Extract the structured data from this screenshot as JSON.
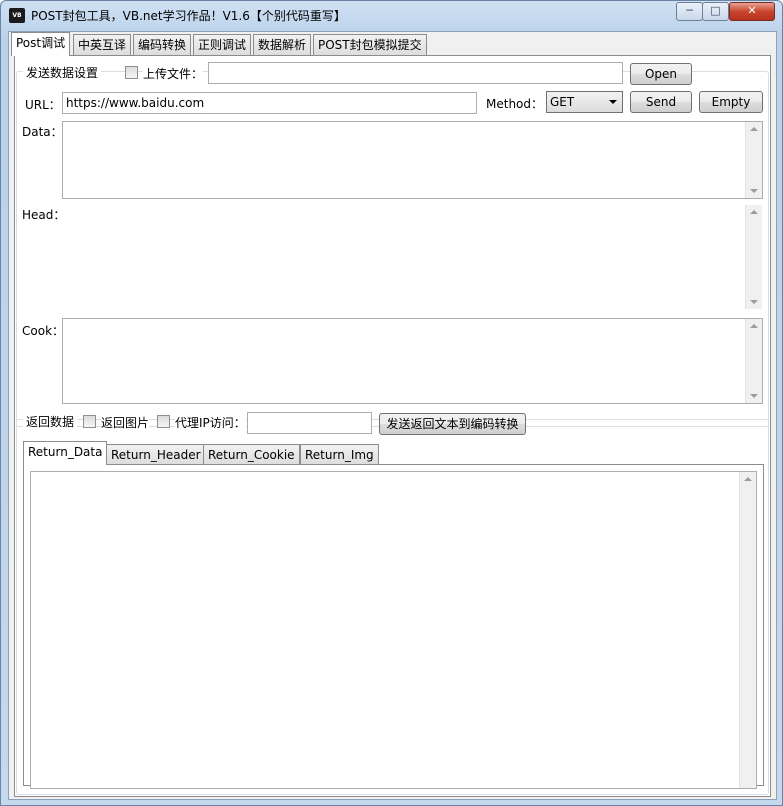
{
  "window": {
    "icon_text": "VB",
    "title": "POST封包工具，VB.net学习作品！V1.6【个别代码重写】",
    "min_glyph": "─",
    "max_glyph": "□",
    "close_glyph": "✕"
  },
  "tabs": [
    "Post调试",
    "中英互译",
    "编码转换",
    "正则调试",
    "数据解析",
    "POST封包模拟提交"
  ],
  "send_settings": {
    "group_label": "发送数据设置",
    "upload_label": "上传文件：",
    "upload_path": "",
    "open_label": "Open",
    "url_label": "URL：",
    "url_value": "https://www.baidu.com",
    "method_label": "Method：",
    "method_value": "GET",
    "send_label": "Send",
    "empty_label": "Empty",
    "data_label": "Data：",
    "head_label": "Head：",
    "cook_label": "Cook："
  },
  "return_settings": {
    "group_label": "返回数据",
    "return_image_label": "返回图片",
    "proxy_label": "代理IP访问：",
    "proxy_value": "",
    "send_to_encode_label": "发送返回文本到编码转换",
    "tabs": [
      "Return_Data",
      "Return_Header",
      "Return_Cookie",
      "Return_Img"
    ]
  }
}
